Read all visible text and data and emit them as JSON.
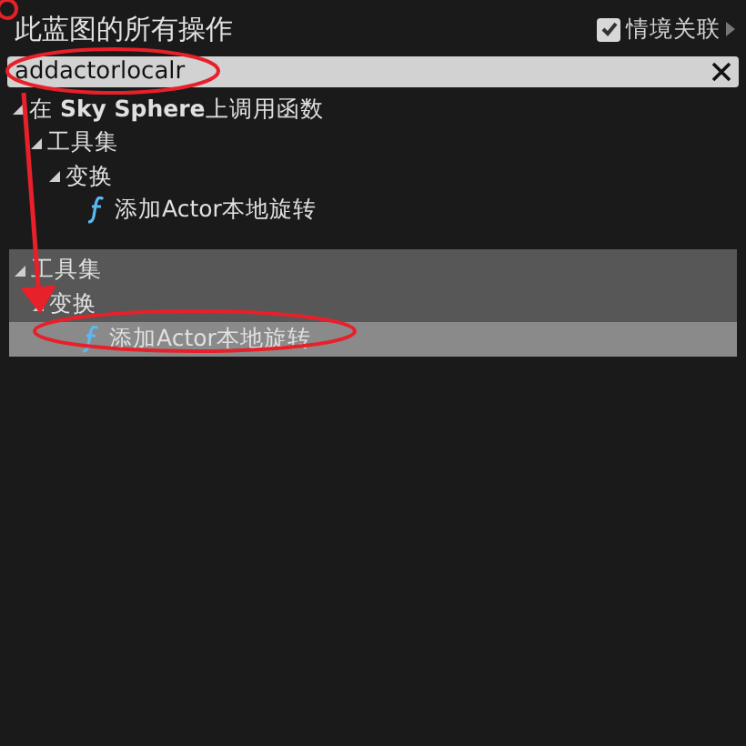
{
  "header": {
    "title": "此蓝图的所有操作",
    "context_toggle": {
      "label": "情境关联",
      "checked": true
    }
  },
  "search": {
    "value": "addactorlocalr"
  },
  "results": [
    {
      "label": "在 **Sky Sphere**上调用函数",
      "kind": "category",
      "expanded": true,
      "selected": false,
      "children": [
        {
          "label": "工具集",
          "kind": "category",
          "expanded": true,
          "selected": false,
          "children": [
            {
              "label": "变换",
              "kind": "category",
              "expanded": true,
              "selected": false,
              "children": [
                {
                  "label": "添加Actor本地旋转",
                  "kind": "function",
                  "selected": false
                }
              ]
            }
          ]
        }
      ]
    }
  ],
  "matches": [
    {
      "label": "工具集",
      "kind": "category",
      "expanded": true,
      "selected": false,
      "children": [
        {
          "label": "变换",
          "kind": "category",
          "expanded": true,
          "selected": false,
          "children": [
            {
              "label": "添加Actor本地旋转",
              "kind": "function",
              "selected": true
            }
          ]
        }
      ]
    }
  ]
}
